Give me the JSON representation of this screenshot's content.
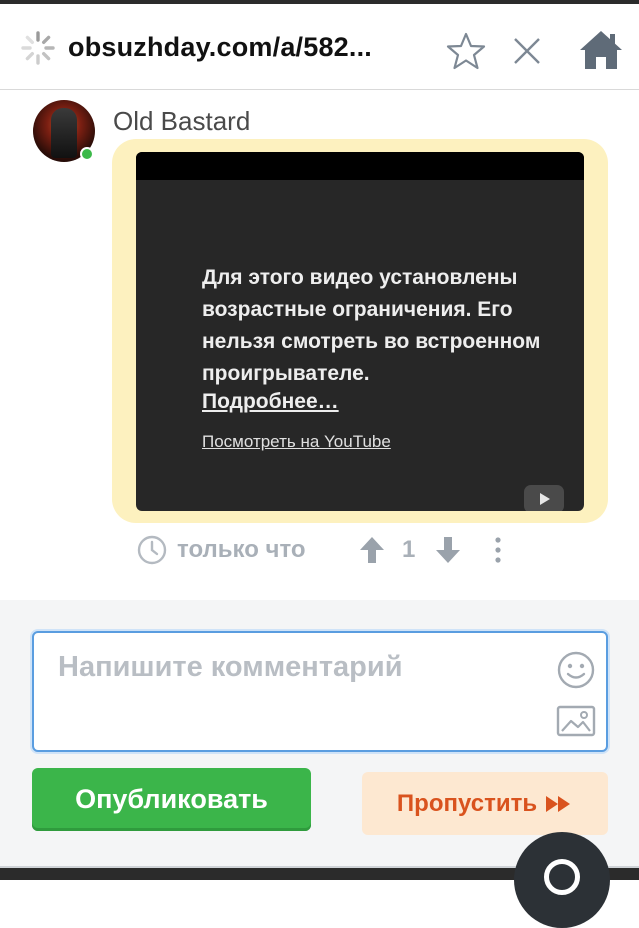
{
  "browser": {
    "url": "obsuzhday.com/a/582...",
    "icons": [
      "loading-spinner-icon",
      "star-icon",
      "close-icon",
      "home-icon"
    ]
  },
  "comment": {
    "author": "Old Bastard",
    "online": true,
    "video": {
      "message": "Для этого видео установлены возрастные ограничения. Его нельзя смотреть во встроенном проигрывателе.",
      "more_link": "Подробнее…",
      "youtube_link": "Посмотреть на YouTube"
    },
    "time": "только что",
    "score": "1"
  },
  "compose": {
    "placeholder": "Напишите комментарий",
    "publish_label": "Опубликовать",
    "skip_label": "Пропустить"
  },
  "colors": {
    "publish": "#3bb54a",
    "skip_bg": "#fde8d1",
    "skip_text": "#d9531e",
    "video_frame": "#fdf1bf",
    "input_border": "#5a9de0"
  }
}
